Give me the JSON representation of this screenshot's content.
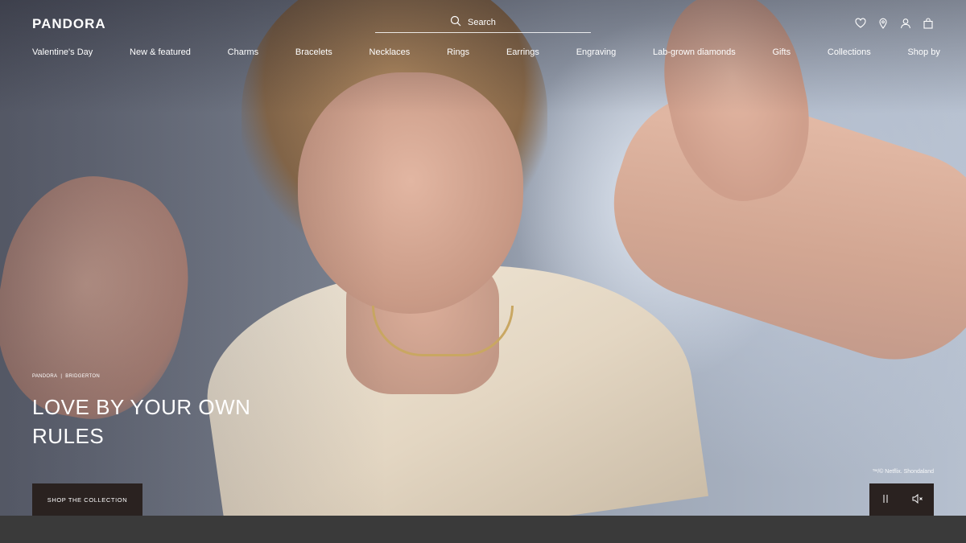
{
  "brand": {
    "logo_text": "PANDORA"
  },
  "search": {
    "placeholder": "Search"
  },
  "header_icons": [
    "heart-icon",
    "location-pin-icon",
    "user-icon",
    "shopping-bag-icon"
  ],
  "nav": {
    "items": [
      "Valentine's Day",
      "New & featured",
      "Charms",
      "Bracelets",
      "Necklaces",
      "Rings",
      "Earrings",
      "Engraving",
      "Lab-grown diamonds",
      "Gifts",
      "Collections",
      "Shop by"
    ]
  },
  "hero": {
    "eyebrow_brand": "PANDORA",
    "eyebrow_separator": "|",
    "eyebrow_partner": "BRIDGERTON",
    "headline": "LOVE BY YOUR OWN RULES",
    "cta_label": "SHOP THE COLLECTION",
    "credit": "™/© Netflix. Shondaland"
  },
  "media_controls": [
    "pause-icon",
    "mute-icon"
  ]
}
